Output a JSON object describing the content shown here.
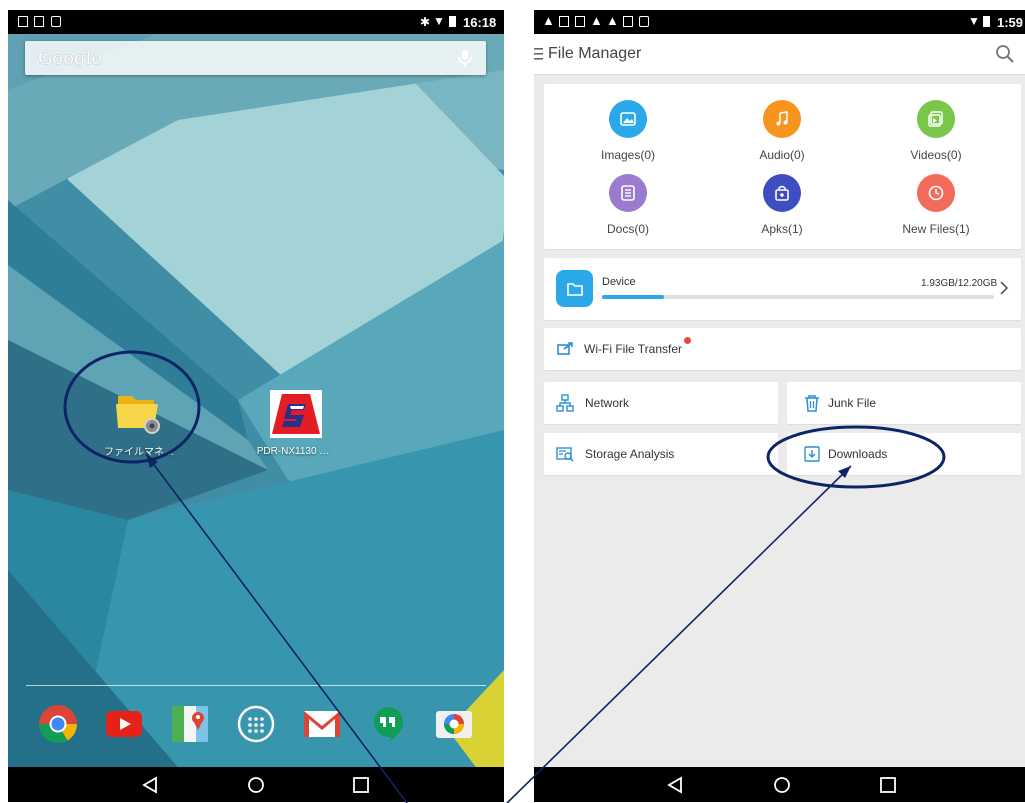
{
  "left_phone": {
    "status_time": "16:18",
    "search_label": "Google",
    "apps": [
      {
        "label": "ファイルマネ…"
      },
      {
        "label": "PDR-NX1130 …"
      }
    ],
    "dock": [
      "chrome-icon",
      "youtube-icon",
      "maps-icon",
      "app-drawer-icon",
      "gmail-icon",
      "hangouts-icon",
      "camera-icon"
    ],
    "nav": [
      "back-icon",
      "home-icon",
      "recents-icon"
    ]
  },
  "right_phone": {
    "status_time": "1:59",
    "title": "File Manager",
    "categories": [
      {
        "label": "Images(0)",
        "color": "#2aa8e8"
      },
      {
        "label": "Audio(0)",
        "color": "#f7941d"
      },
      {
        "label": "Videos(0)",
        "color": "#79c64b"
      },
      {
        "label": "Docs(0)",
        "color": "#9b7bd0"
      },
      {
        "label": "Apks(1)",
        "color": "#3e4ec0"
      },
      {
        "label": "New Files(1)",
        "color": "#f26b5b"
      }
    ],
    "storage": {
      "label": "Device",
      "size": "1.93GB/12.20GB",
      "used_fraction": 0.158
    },
    "wifi": {
      "label": "Wi-Fi File Transfer"
    },
    "tools": [
      {
        "label": "Network"
      },
      {
        "label": "Junk File"
      },
      {
        "label": "Storage Analysis"
      },
      {
        "label": "Downloads"
      }
    ],
    "nav": [
      "back-icon",
      "home-icon",
      "recents-icon"
    ]
  },
  "colors": {
    "accent": "#2aa8e8",
    "annotation": "#0d2466",
    "badge": "#e74c3c"
  }
}
